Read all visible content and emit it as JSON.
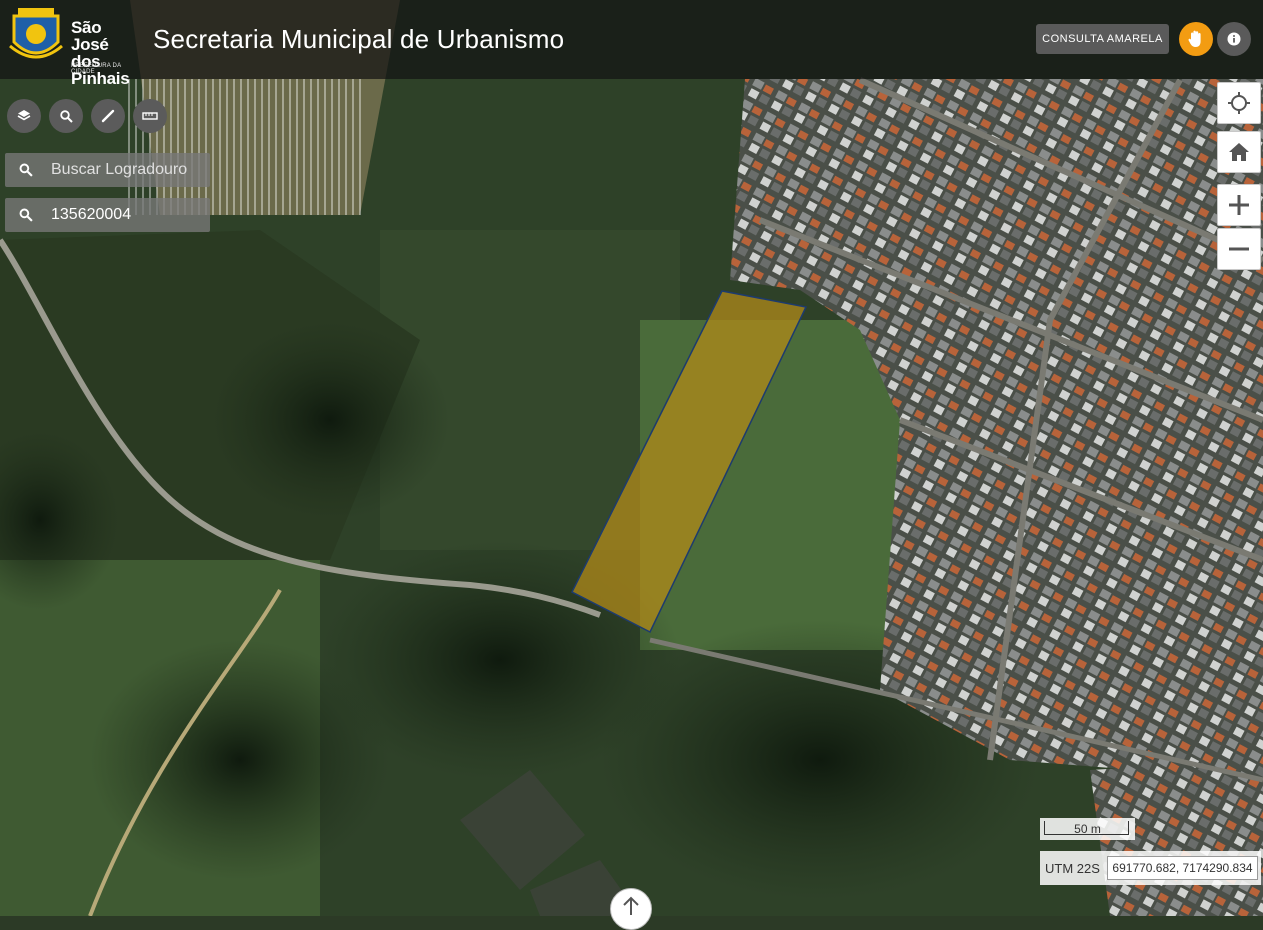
{
  "header": {
    "logo_line1": "São José",
    "logo_line2": "dos Pinhais",
    "logo_sub": "PREFEITURA DA CIDADE",
    "title": "Secretaria Municipal de Urbanismo",
    "consulta_label": "CONSULTA AMARELA"
  },
  "tools": {
    "layers_icon": "layers-icon",
    "search_icon": "search-icon",
    "draw_icon": "pencil-icon",
    "measure_icon": "ruler-icon"
  },
  "search": {
    "street_placeholder": "Buscar Logradouro",
    "street_value": "",
    "lot_value": "135620004"
  },
  "map_controls": [
    "locate-icon",
    "home-icon",
    "zoom-in-icon",
    "zoom-out-icon"
  ],
  "scale": {
    "label": "50 m"
  },
  "coordinates": {
    "label": "UTM 22S",
    "value": "691770.682, 7174290.834"
  },
  "colors": {
    "accent": "#f39c12",
    "highlight_parcel": "#b08a1a",
    "header_bg": "#141414"
  }
}
